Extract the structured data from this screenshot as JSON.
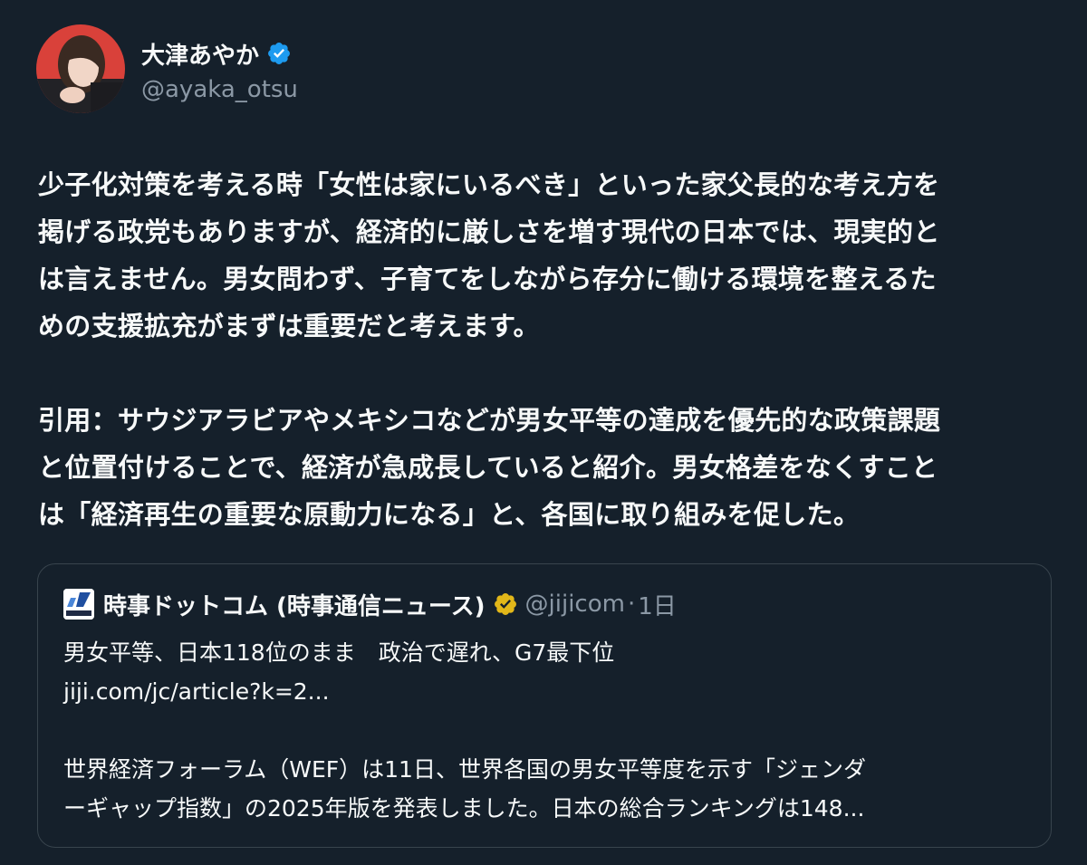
{
  "author": {
    "display_name": "大津あやか",
    "handle": "@ayaka_otsu",
    "verified_icon": "verified-badge-blue",
    "avatar_icon": "profile-photo"
  },
  "tweet": {
    "paragraph1": "少子化対策を考える時「女性は家にいるべき」といった家父長的な考え方を\n掲げる政党もありますが、経済的に厳しさを増す現代の日本では、現実的と\nは言えません。男女問わず、子育てをしながら存分に働ける環境を整えるた\nめの支援拡充がまずは重要だと考えます。",
    "paragraph2": "引用：サウジアラビアやメキシコなどが男女平等の達成を優先的な政策課題\nと位置付けることで、経済が急成長していると紹介。男女格差をなくすこと\nは「経済再生の重要な原動力になる」と、各国に取り組みを促した。"
  },
  "quote": {
    "logo_icon": "jiji-com-logo",
    "name": "時事ドットコム (時事通信ニュース)",
    "verified_icon": "verified-badge-gold",
    "handle": "@jijicom",
    "separator": "·",
    "time": "1日",
    "headline": "男女平等、日本118位のまま　政治で遅れ、G7最下位",
    "link": "jiji.com/jc/article?k=2...",
    "body_line1": "世界経済フォーラム（WEF）は11日、世界各国の男女平等度を示す「ジェンダ",
    "body_line2": "ーギャップ指数」の2025年版を発表しました。日本の総合ランキングは148..."
  },
  "colors": {
    "background": "#15202b",
    "text": "#f7f9f9",
    "secondary_text": "#8b98a5",
    "border": "#38444d",
    "verified_blue": "#1d9bf0",
    "verified_gold": "#e2b719"
  }
}
